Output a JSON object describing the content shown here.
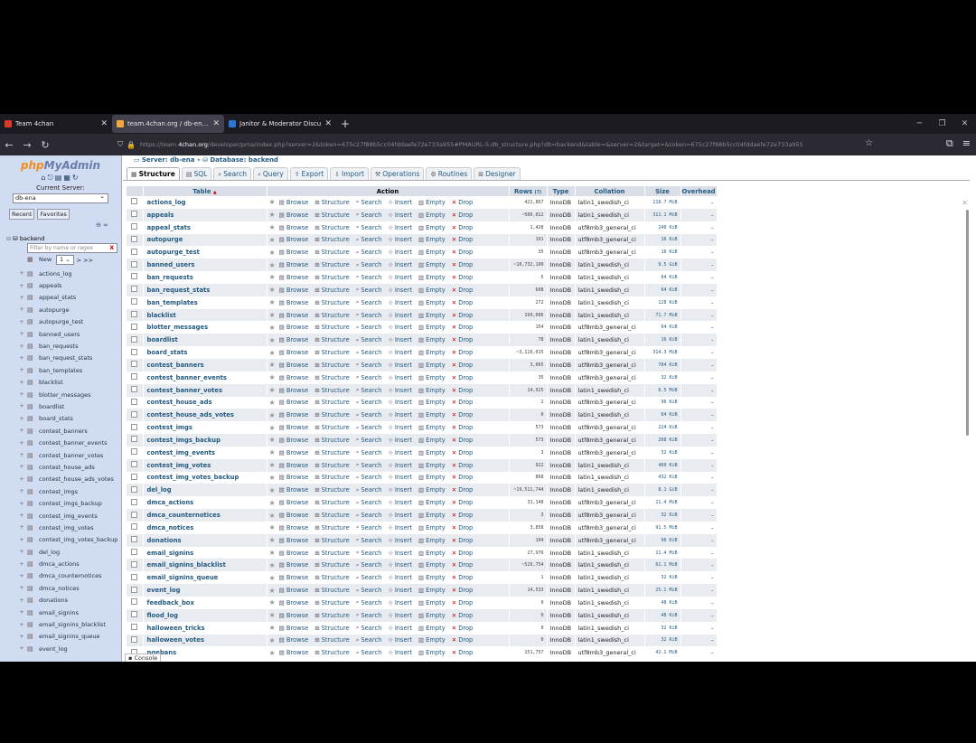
{
  "browser": {
    "tabs": [
      {
        "title": "Team 4chan",
        "active": false,
        "color": "#d7392b"
      },
      {
        "title": "team.4chan.org / db-ena / back",
        "active": true,
        "color": "#f4a73b"
      },
      {
        "title": "Janitor & Moderator Discu",
        "active": false,
        "color": "#2b77d7"
      }
    ],
    "url_prefix": "https://team.",
    "url_host": "4chan.org",
    "url_path": "/developer/pma/index.php?server=2&token=675c27f88b5cc04fddaefe72e733a955#PMAURL-5:db_structure.php?db=backend&table=&server=2&target=&token=675c27f88b5cc04fddaefe72e733a955"
  },
  "sidebar": {
    "logo_php": "php",
    "logo_myadmin": "MyAdmin",
    "current_server_label": "Current Server:",
    "server_value": "db-ena",
    "recent_label": "Recent",
    "favorites_label": "Favorites",
    "db_name": "backend",
    "filter_placeholder": "Filter by name or regex",
    "page_value": "1",
    "page_nav": "> >>",
    "new_label": "New",
    "tree": [
      "actions_log",
      "appeals",
      "appeal_stats",
      "autopurge",
      "autopurge_test",
      "banned_users",
      "ban_requests",
      "ban_request_stats",
      "ban_templates",
      "blacklist",
      "blotter_messages",
      "boardlist",
      "board_stats",
      "contest_banners",
      "contest_banner_events",
      "contest_banner_votes",
      "contest_house_ads",
      "contest_house_ads_votes",
      "contest_imgs",
      "contest_imgs_backup",
      "contest_img_events",
      "contest_img_votes",
      "contest_img_votes_backup",
      "del_log",
      "dmca_actions",
      "dmca_counternotices",
      "dmca_notices",
      "donations",
      "email_signins",
      "email_signins_blacklist",
      "email_signins_queue",
      "event_log"
    ]
  },
  "main": {
    "breadcrumb_server": "Server: db-ena",
    "breadcrumb_sep": "»",
    "breadcrumb_db": "Database: backend",
    "tabs": [
      "Structure",
      "SQL",
      "Search",
      "Query",
      "Export",
      "Import",
      "Operations",
      "Routines",
      "Designer"
    ],
    "headers": {
      "table": "Table",
      "sort": "▲",
      "action": "Action",
      "rows": "Rows",
      "rows_help": "?",
      "type": "Type",
      "collation": "Collation",
      "size": "Size",
      "overhead": "Overhead"
    },
    "actions": {
      "browse": "Browse",
      "structure": "Structure",
      "search": "Search",
      "insert": "Insert",
      "empty": "Empty",
      "drop": "Drop"
    },
    "rows": [
      {
        "name": "actions_log",
        "rows": "422,867",
        "type": "InnoDB",
        "collation": "latin1_swedish_ci",
        "size": "118.7 MiB",
        "overhead": "-"
      },
      {
        "name": "appeals",
        "rows": "~500,022",
        "type": "InnoDB",
        "collation": "latin1_swedish_ci",
        "size": "311.1 MiB",
        "overhead": "-"
      },
      {
        "name": "appeal_stats",
        "rows": "1,428",
        "type": "InnoDB",
        "collation": "utf8mb3_general_ci",
        "size": "240 KiB",
        "overhead": "-"
      },
      {
        "name": "autopurge",
        "rows": "101",
        "type": "InnoDB",
        "collation": "utf8mb3_general_ci",
        "size": "16 KiB",
        "overhead": "-"
      },
      {
        "name": "autopurge_test",
        "rows": "35",
        "type": "InnoDB",
        "collation": "utf8mb3_general_ci",
        "size": "16 KiB",
        "overhead": "-"
      },
      {
        "name": "banned_users",
        "rows": "~10,732,100",
        "type": "InnoDB",
        "collation": "latin1_swedish_ci",
        "size": "9.5 GiB",
        "overhead": "-"
      },
      {
        "name": "ban_requests",
        "rows": "5",
        "type": "InnoDB",
        "collation": "latin1_swedish_ci",
        "size": "64 KiB",
        "overhead": "-"
      },
      {
        "name": "ban_request_stats",
        "rows": "608",
        "type": "InnoDB",
        "collation": "latin1_swedish_ci",
        "size": "64 KiB",
        "overhead": "-"
      },
      {
        "name": "ban_templates",
        "rows": "272",
        "type": "InnoDB",
        "collation": "latin1_swedish_ci",
        "size": "128 KiB",
        "overhead": "-"
      },
      {
        "name": "blacklist",
        "rows": "199,006",
        "type": "InnoDB",
        "collation": "latin1_swedish_ci",
        "size": "71.7 MiB",
        "overhead": "-"
      },
      {
        "name": "blotter_messages",
        "rows": "154",
        "type": "InnoDB",
        "collation": "utf8mb3_general_ci",
        "size": "64 KiB",
        "overhead": "-"
      },
      {
        "name": "boardlist",
        "rows": "78",
        "type": "InnoDB",
        "collation": "latin1_swedish_ci",
        "size": "16 KiB",
        "overhead": "-"
      },
      {
        "name": "board_stats",
        "rows": "~3,116,015",
        "type": "InnoDB",
        "collation": "utf8mb3_general_ci",
        "size": "314.3 MiB",
        "overhead": "-"
      },
      {
        "name": "contest_banners",
        "rows": "3,065",
        "type": "InnoDB",
        "collation": "utf8mb3_general_ci",
        "size": "784 KiB",
        "overhead": "-"
      },
      {
        "name": "contest_banner_events",
        "rows": "35",
        "type": "InnoDB",
        "collation": "utf8mb3_general_ci",
        "size": "32 KiB",
        "overhead": "-"
      },
      {
        "name": "contest_banner_votes",
        "rows": "14,925",
        "type": "InnoDB",
        "collation": "latin1_swedish_ci",
        "size": "6.5 MiB",
        "overhead": "-"
      },
      {
        "name": "contest_house_ads",
        "rows": "2",
        "type": "InnoDB",
        "collation": "utf8mb3_general_ci",
        "size": "96 KiB",
        "overhead": "-"
      },
      {
        "name": "contest_house_ads_votes",
        "rows": "0",
        "type": "InnoDB",
        "collation": "latin1_swedish_ci",
        "size": "64 KiB",
        "overhead": "-"
      },
      {
        "name": "contest_imgs",
        "rows": "573",
        "type": "InnoDB",
        "collation": "utf8mb3_general_ci",
        "size": "224 KiB",
        "overhead": "-"
      },
      {
        "name": "contest_imgs_backup",
        "rows": "573",
        "type": "InnoDB",
        "collation": "utf8mb3_general_ci",
        "size": "208 KiB",
        "overhead": "-"
      },
      {
        "name": "contest_img_events",
        "rows": "3",
        "type": "InnoDB",
        "collation": "utf8mb3_general_ci",
        "size": "32 KiB",
        "overhead": "-"
      },
      {
        "name": "contest_img_votes",
        "rows": "922",
        "type": "InnoDB",
        "collation": "latin1_swedish_ci",
        "size": "400 KiB",
        "overhead": "-"
      },
      {
        "name": "contest_img_votes_backup",
        "rows": "868",
        "type": "InnoDB",
        "collation": "latin1_swedish_ci",
        "size": "432 KiB",
        "overhead": "-"
      },
      {
        "name": "del_log",
        "rows": "~19,511,744",
        "type": "InnoDB",
        "collation": "latin1_swedish_ci",
        "size": "8.1 GiB",
        "overhead": "-"
      },
      {
        "name": "dmca_actions",
        "rows": "31,148",
        "type": "InnoDB",
        "collation": "utf8mb3_general_ci",
        "size": "11.4 MiB",
        "overhead": "-"
      },
      {
        "name": "dmca_counternotices",
        "rows": "3",
        "type": "InnoDB",
        "collation": "utf8mb3_general_ci",
        "size": "32 KiB",
        "overhead": "-"
      },
      {
        "name": "dmca_notices",
        "rows": "3,858",
        "type": "InnoDB",
        "collation": "utf8mb3_general_ci",
        "size": "91.5 MiB",
        "overhead": "-"
      },
      {
        "name": "donations",
        "rows": "104",
        "type": "InnoDB",
        "collation": "utf8mb3_general_ci",
        "size": "96 KiB",
        "overhead": "-"
      },
      {
        "name": "email_signins",
        "rows": "27,976",
        "type": "InnoDB",
        "collation": "latin1_swedish_ci",
        "size": "11.4 MiB",
        "overhead": "-"
      },
      {
        "name": "email_signins_blacklist",
        "rows": "~529,754",
        "type": "InnoDB",
        "collation": "latin1_swedish_ci",
        "size": "61.1 MiB",
        "overhead": "-"
      },
      {
        "name": "email_signins_queue",
        "rows": "1",
        "type": "InnoDB",
        "collation": "latin1_swedish_ci",
        "size": "32 KiB",
        "overhead": "-"
      },
      {
        "name": "event_log",
        "rows": "14,533",
        "type": "InnoDB",
        "collation": "latin1_swedish_ci",
        "size": "25.1 MiB",
        "overhead": "-"
      },
      {
        "name": "feedback_box",
        "rows": "0",
        "type": "InnoDB",
        "collation": "latin1_swedish_ci",
        "size": "48 KiB",
        "overhead": "-"
      },
      {
        "name": "flood_log",
        "rows": "0",
        "type": "InnoDB",
        "collation": "latin1_swedish_ci",
        "size": "48 KiB",
        "overhead": "-"
      },
      {
        "name": "halloween_tricks",
        "rows": "0",
        "type": "InnoDB",
        "collation": "latin1_swedish_ci",
        "size": "32 KiB",
        "overhead": "-"
      },
      {
        "name": "halloween_votes",
        "rows": "0",
        "type": "InnoDB",
        "collation": "latin1_swedish_ci",
        "size": "32 KiB",
        "overhead": "-"
      },
      {
        "name": "ngebans",
        "rows": "151,757",
        "type": "InnoDB",
        "collation": "utf8mb3_general_ci",
        "size": "42.1 MiB",
        "overhead": "-"
      }
    ],
    "console_label": "Console"
  }
}
